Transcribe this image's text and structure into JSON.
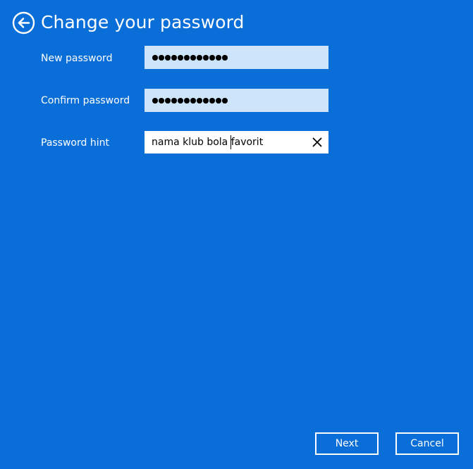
{
  "header": {
    "title": "Change your password",
    "back_icon": "back-arrow-icon"
  },
  "form": {
    "new_password": {
      "label": "New password",
      "masked_length": 12
    },
    "confirm_password": {
      "label": "Confirm password",
      "masked_length": 12
    },
    "password_hint": {
      "label": "Password hint",
      "value": "nama klub bola favorit",
      "clear_icon": "close-icon"
    }
  },
  "footer": {
    "next_label": "Next",
    "cancel_label": "Cancel"
  },
  "colors": {
    "background": "#0a6ed8",
    "filled_field": "#cde4fa",
    "text": "#ffffff"
  }
}
